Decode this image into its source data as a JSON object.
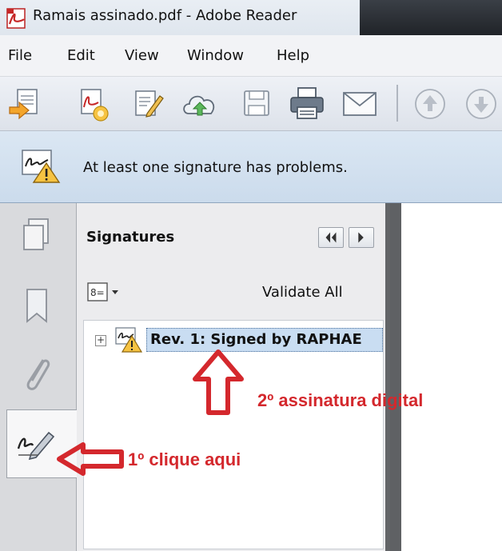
{
  "window": {
    "title": "Ramais assinado.pdf - Adobe Reader"
  },
  "menu": [
    "File",
    "Edit",
    "View",
    "Window",
    "Help"
  ],
  "toolbar": {
    "buttons": [
      "create-pdf-icon",
      "export-pdf-icon",
      "edit-pdf-icon",
      "upload-cloud-icon",
      "save-icon",
      "print-icon",
      "email-icon",
      "previous-page-icon",
      "next-page-icon"
    ]
  },
  "notification": {
    "message": "At least one signature has problems."
  },
  "panel": {
    "title": "Signatures",
    "validate_all": "Validate All",
    "expander": "+",
    "signature_label": "Rev. 1: Signed by RAPHAE"
  },
  "annotations": {
    "second_signature": "2º assinatura digital",
    "first_click": "1º clique aqui"
  },
  "colors": {
    "annotation": "#d4282d",
    "notification_bg": "#cbdbec",
    "selection": "#c9ddf2"
  }
}
